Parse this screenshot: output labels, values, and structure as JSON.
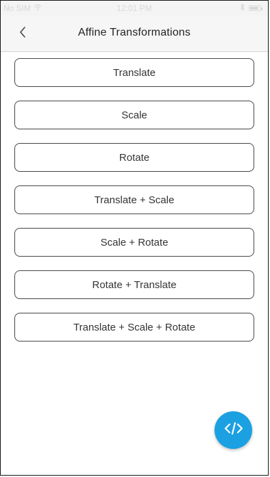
{
  "status_bar": {
    "carrier": "No SIM",
    "time": "12:01 PM"
  },
  "header": {
    "title": "Affine Transformations",
    "back_icon": "chevron-left-icon"
  },
  "buttons": [
    "Translate",
    "Scale",
    "Rotate",
    "Translate + Scale",
    "Scale + Rotate",
    "Rotate + Translate",
    "Translate + Scale + Rotate"
  ],
  "fab": {
    "icon": "code-icon"
  },
  "colors": {
    "accent": "#1ba1e2",
    "nav_background": "#f6f6f6",
    "text": "#333333",
    "border": "#444444"
  }
}
